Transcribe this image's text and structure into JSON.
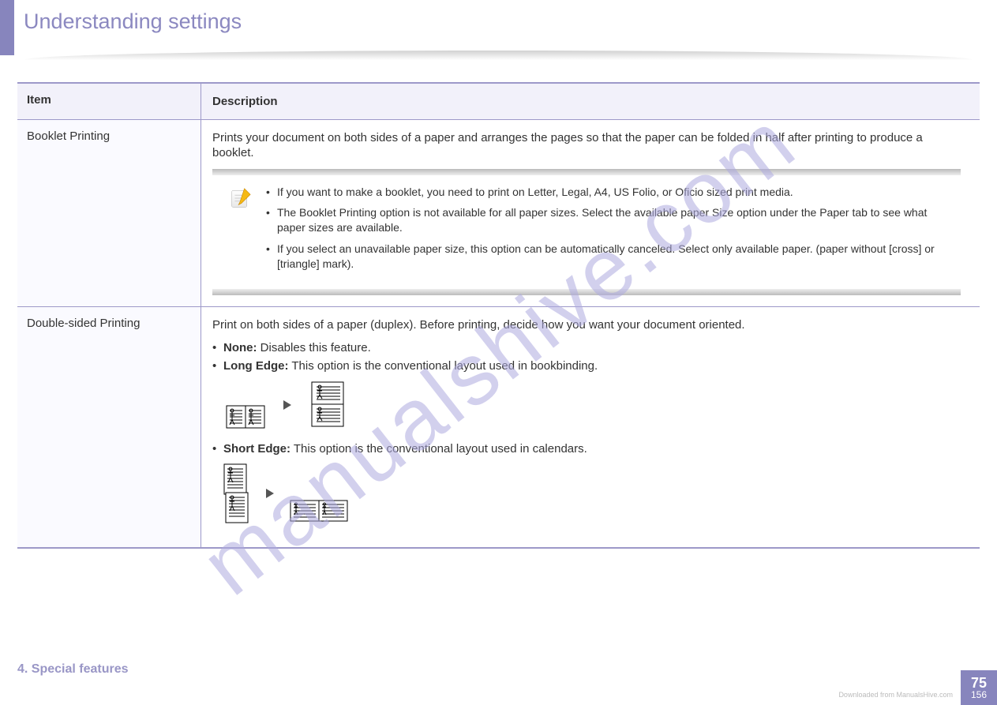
{
  "watermark": "manualshive.com",
  "page_title": "Understanding settings",
  "columns": {
    "left": "Item",
    "right": "Description"
  },
  "row1": {
    "item": "Booklet Printing",
    "description": "Prints your document on both sides of a paper and arranges the pages so that the paper can be folded in half after printing to produce a booklet.",
    "note_bullets": [
      "If you want to make a booklet, you need to print on Letter, Legal, A4, US Folio, or Oficio sized print media.",
      "The Booklet Printing option is not available for all paper sizes. Select the available paper Size option under the Paper tab to see what paper sizes are available.",
      "If you select an unavailable paper size, this option can be automatically canceled. Select only available paper. (paper without [cross] or [triangle] mark)."
    ]
  },
  "row2": {
    "item": "Double-sided Printing",
    "description": "Print on both sides of a paper (duplex). Before printing, decide how you want your document oriented.",
    "bullets": [
      {
        "label": "None:",
        "text": " Disables this feature."
      },
      {
        "label": "Long Edge:",
        "text": " This option is the conventional layout used in bookbinding."
      },
      {
        "label": "Short Edge:",
        "text": " This option is the conventional layout used in calendars."
      }
    ]
  },
  "footer": {
    "chapter": "4. Special features",
    "page_top": "75",
    "page_bottom": "156",
    "docnote": "Downloaded from ManualsHive.com"
  }
}
